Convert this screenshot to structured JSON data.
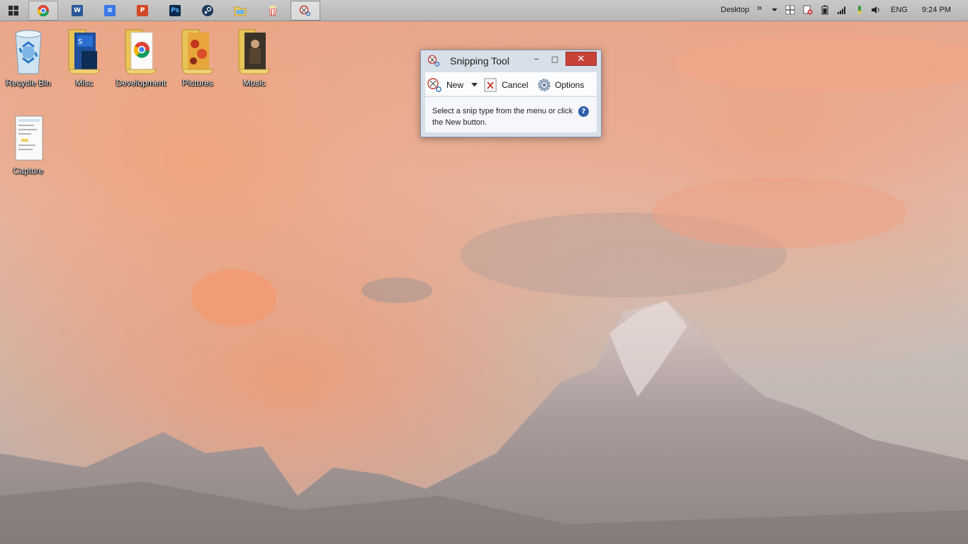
{
  "taskbar": {
    "start": {
      "icon": "windows-logo-icon"
    },
    "apps": [
      {
        "name": "chrome",
        "icon": "chrome-icon",
        "state": "pinned-active"
      },
      {
        "name": "word",
        "icon": "word-icon",
        "glyph": "W"
      },
      {
        "name": "docs",
        "icon": "document-icon",
        "glyph": "≡"
      },
      {
        "name": "powerpoint",
        "icon": "powerpoint-icon",
        "glyph": "P"
      },
      {
        "name": "photoshop",
        "icon": "photoshop-icon",
        "glyph": "Ps"
      },
      {
        "name": "steam",
        "icon": "steam-icon"
      },
      {
        "name": "file-explorer",
        "icon": "folder-icon"
      },
      {
        "name": "popcorn",
        "icon": "popcorn-icon"
      },
      {
        "name": "snipping-tool",
        "icon": "snipping-tool-icon",
        "state": "active"
      }
    ],
    "tray": {
      "desktop_label": "Desktop",
      "overflow": "»",
      "language": "ENG",
      "clock": "9:24 PM"
    }
  },
  "desktop": {
    "icons": [
      {
        "label": "Recycle Bin",
        "icon": "recycle-bin-icon"
      },
      {
        "label": "Misc",
        "icon": "folder-icon"
      },
      {
        "label": "Development",
        "icon": "folder-icon"
      },
      {
        "label": "Pictures",
        "icon": "folder-icon"
      },
      {
        "label": "Music",
        "icon": "folder-icon"
      },
      {
        "label": "Capture",
        "icon": "image-file-icon"
      }
    ]
  },
  "snipping_tool": {
    "title": "Snipping Tool",
    "minimize": "–",
    "maximize": "□",
    "close": "✕",
    "new_label": "New",
    "cancel_label": "Cancel",
    "options_label": "Options",
    "message": "Select a snip type from the menu or click the New button.",
    "help": "?"
  },
  "colors": {
    "taskbar": "#bdbdbd",
    "close_button": "#c7433a",
    "window_frame": "#d7dfe9"
  }
}
